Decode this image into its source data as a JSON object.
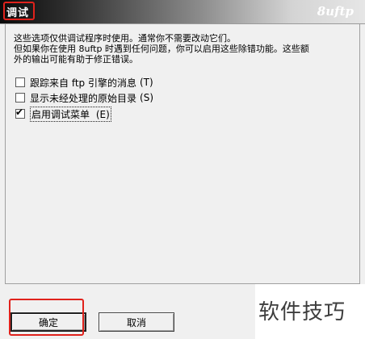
{
  "window": {
    "title": "调试",
    "brand": "8uftp"
  },
  "description": {
    "line1": "这些选项仅供调试程序时使用。通常你不需要改动它们。",
    "line2": "但如果你在使用 8uftp 时遇到任何问题，你可以启用这些除错功能。这些额",
    "line3": "外的输出可能有助于修正错误。"
  },
  "options": [
    {
      "label": "跟踪来自 ftp 引擎的消息",
      "shortcut": "(T)",
      "checked": false
    },
    {
      "label": "显示未经处理的原始目录",
      "shortcut": "(S)",
      "checked": false
    },
    {
      "label": "启用调试菜单",
      "shortcut": "(E)",
      "checked": true
    }
  ],
  "buttons": {
    "ok": "确定",
    "cancel": "取消"
  },
  "watermark": "软件技巧",
  "annotation_color": "#e0221c"
}
